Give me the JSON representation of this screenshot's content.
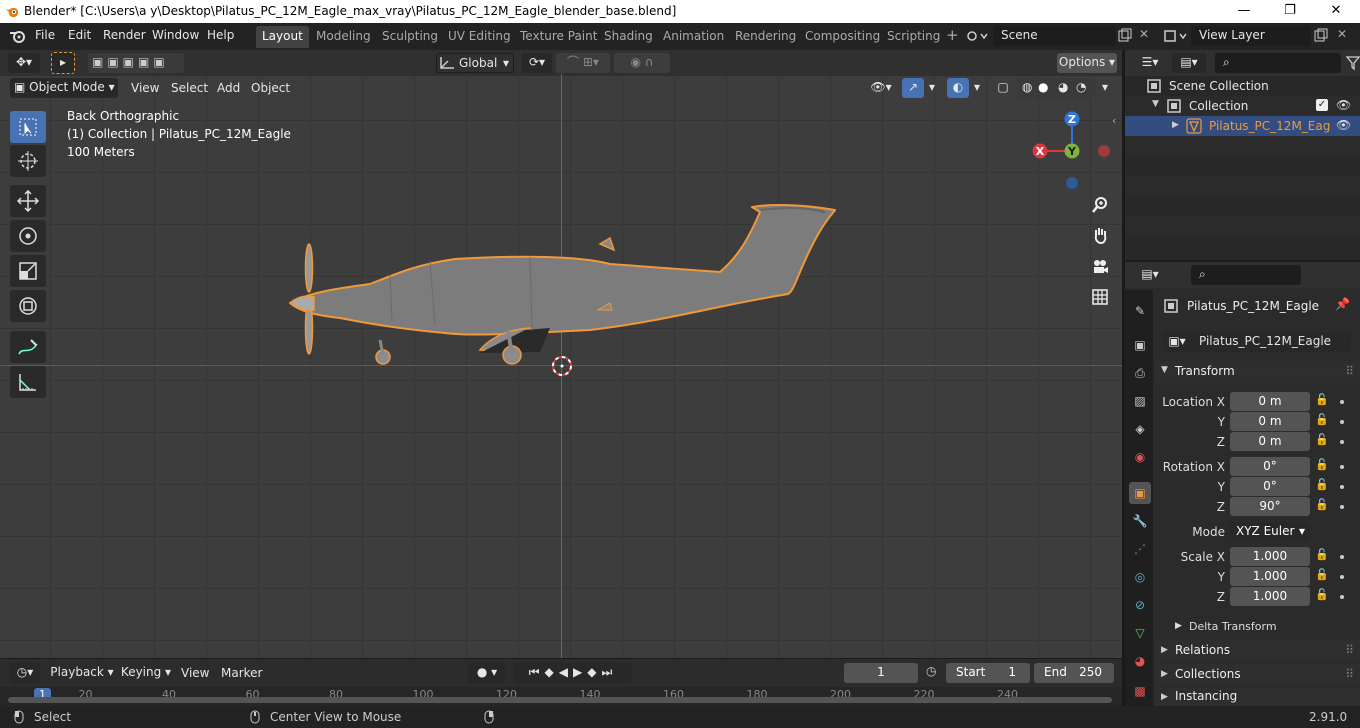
{
  "title_bar": {
    "text": "Blender* [C:\\Users\\a y\\Desktop\\Pilatus_PC_12M_Eagle_max_vray\\Pilatus_PC_12M_Eagle_blender_base.blend]",
    "minimize": "—",
    "maximize": "❐",
    "close": "✕"
  },
  "menu": {
    "file": "File",
    "edit": "Edit",
    "render": "Render",
    "window": "Window",
    "help": "Help"
  },
  "workspaces": [
    "Layout",
    "Modeling",
    "Sculpting",
    "UV Editing",
    "Texture Paint",
    "Shading",
    "Animation",
    "Rendering",
    "Compositing",
    "Scripting"
  ],
  "scene_name": "Scene",
  "view_layer_name": "View Layer",
  "viewport_header": {
    "transform_orientation": "Global",
    "options": "Options",
    "mode": "Object Mode",
    "view": "View",
    "select": "Select",
    "add": "Add",
    "object": "Object"
  },
  "viewport_overlay": {
    "view_name": "Back Orthographic",
    "collection_info": "(1) Collection | Pilatus_PC_12M_Eagle",
    "scale": "100 Meters"
  },
  "gizmo": {
    "x": "X",
    "y": "Y",
    "z": "Z"
  },
  "outliner": {
    "scene_collection": "Scene Collection",
    "collection": "Collection",
    "object": "Pilatus_PC_12M_Eag"
  },
  "properties": {
    "object_name": "Pilatus_PC_12M_Eagle",
    "data_name": "Pilatus_PC_12M_Eagle",
    "transform_title": "Transform",
    "location_label": "Location X",
    "y_label": "Y",
    "z_label": "Z",
    "location": [
      "0 m",
      "0 m",
      "0 m"
    ],
    "rotation_label": "Rotation X",
    "rotation": [
      "0°",
      "0°",
      "90°"
    ],
    "mode_label": "Mode",
    "mode_value": "XYZ Euler",
    "scale_label": "Scale X",
    "scale": [
      "1.000",
      "1.000",
      "1.000"
    ],
    "delta_transform": "Delta Transform",
    "relations": "Relations",
    "collections": "Collections",
    "instancing": "Instancing"
  },
  "timeline": {
    "playback": "Playback",
    "keying": "Keying",
    "view": "View",
    "marker": "Marker",
    "current_frame": "1",
    "start_label": "Start",
    "start": "1",
    "end_label": "End",
    "end": "250",
    "ruler": [
      "1",
      "20",
      "40",
      "60",
      "80",
      "100",
      "120",
      "140",
      "160",
      "180",
      "200",
      "220",
      "240"
    ]
  },
  "status_bar": {
    "select": "Select",
    "center_view": "Center View to Mouse",
    "version": "2.91.0"
  },
  "colors": {
    "accent_blue": "#4772b3",
    "selection_orange": "#f0993a",
    "x_axis": "#d8393e",
    "y_axis": "#7fb33e",
    "z_axis": "#2f76d6"
  }
}
